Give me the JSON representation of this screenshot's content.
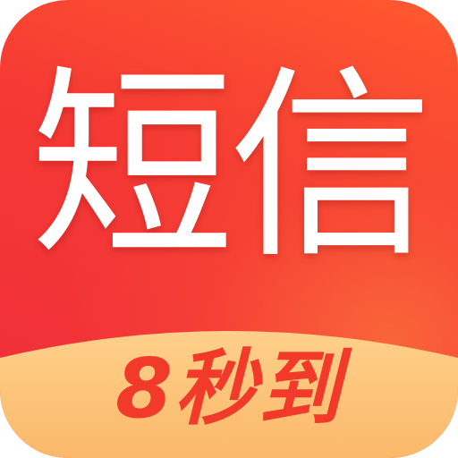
{
  "app_icon": {
    "title": "短信",
    "tagline": "8秒到",
    "colors": {
      "background_top": "#ff5a2e",
      "background_main": "#ef2d3a",
      "title_text": "#ffffff",
      "banner_fill": "#fdc37a",
      "tagline_text": "#f23a2a"
    }
  }
}
